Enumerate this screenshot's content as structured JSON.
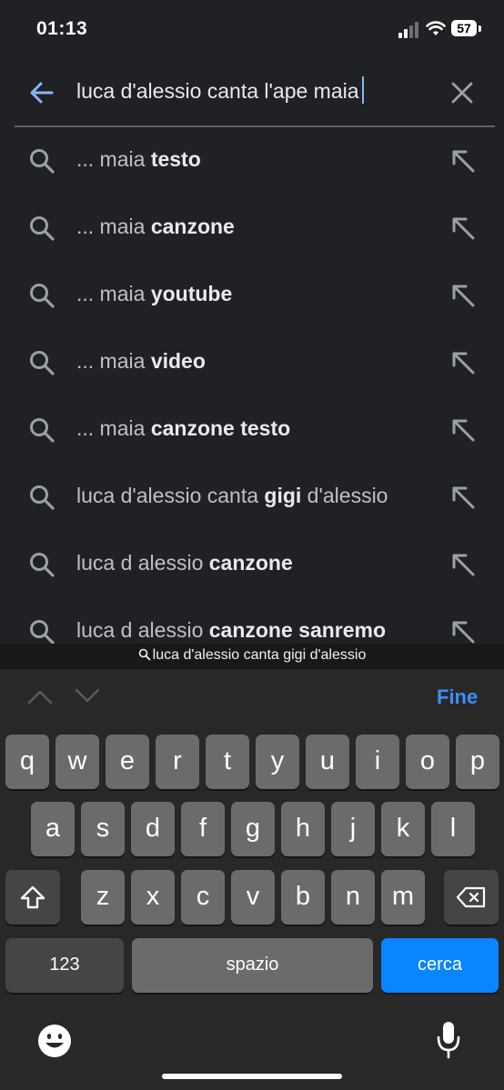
{
  "status_bar": {
    "time": "01:13",
    "battery": "57"
  },
  "search": {
    "query": "luca d'alessio canta l'ape maia"
  },
  "suggestions": [
    {
      "prefix": "... maia ",
      "bold": "testo"
    },
    {
      "prefix": "... maia ",
      "bold": "canzone"
    },
    {
      "prefix": "... maia ",
      "bold": "youtube"
    },
    {
      "prefix": "... maia ",
      "bold": "video"
    },
    {
      "prefix": "... maia ",
      "bold": "canzone testo"
    },
    {
      "prefix": "luca d'alessio canta ",
      "bold": "gigi",
      "suffix": " d'alessio"
    },
    {
      "prefix": "luca d alessio ",
      "bold": "canzone"
    },
    {
      "prefix": "luca d alessio ",
      "bold": "canzone sanremo"
    }
  ],
  "keyboard_suggestion": "luca d'alessio canta gigi d'alessio",
  "accessory": {
    "done_label": "Fine"
  },
  "keyboard": {
    "row1": [
      "q",
      "w",
      "e",
      "r",
      "t",
      "y",
      "u",
      "i",
      "o",
      "p"
    ],
    "row2": [
      "a",
      "s",
      "d",
      "f",
      "g",
      "h",
      "j",
      "k",
      "l"
    ],
    "row3": [
      "z",
      "x",
      "c",
      "v",
      "b",
      "n",
      "m"
    ],
    "numbers_label": "123",
    "space_label": "spazio",
    "search_label": "cerca"
  },
  "colors": {
    "background": "#202124",
    "accent": "#8ab4f8",
    "keyboard_blue": "#0a84ff",
    "done_blue": "#3e8ef7"
  },
  "icons": [
    "back-arrow-icon",
    "clear-icon",
    "search-icon",
    "fill-arrow-icon",
    "shift-icon",
    "backspace-icon",
    "emoji-icon",
    "microphone-icon"
  ]
}
